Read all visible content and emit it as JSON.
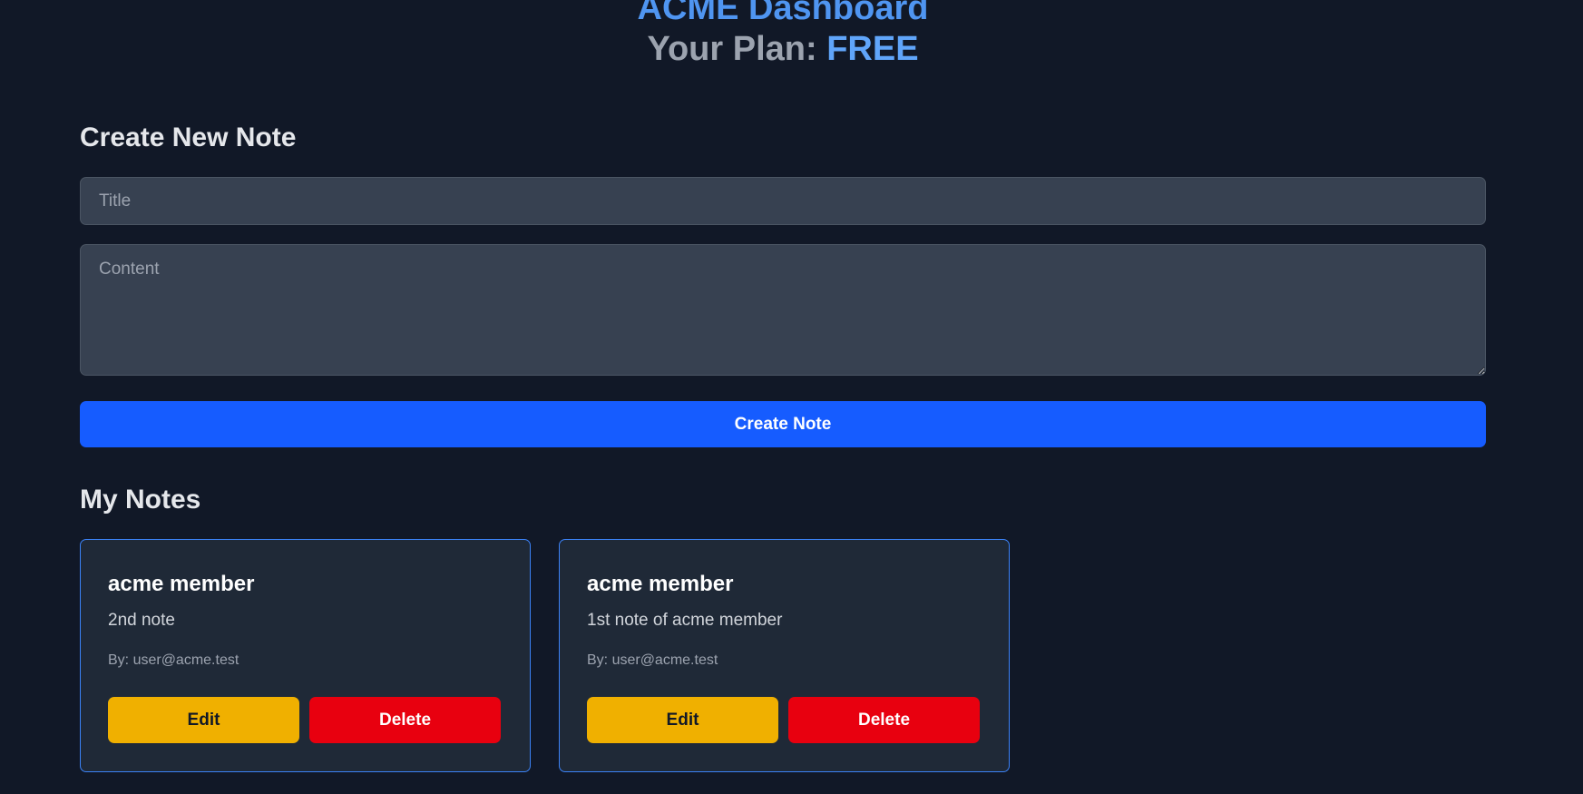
{
  "header": {
    "title": "ACME Dashboard",
    "plan_label": "Your Plan: ",
    "plan_value": "FREE"
  },
  "create_section": {
    "heading": "Create New Note",
    "title_placeholder": "Title",
    "title_value": "",
    "content_placeholder": "Content",
    "content_value": "",
    "submit_label": "Create Note"
  },
  "notes_section": {
    "heading": "My Notes",
    "notes": [
      {
        "title": "acme member",
        "body": "2nd note",
        "author": "By: user@acme.test",
        "edit_label": "Edit",
        "delete_label": "Delete"
      },
      {
        "title": "acme member",
        "body": "1st note of acme member",
        "author": "By: user@acme.test",
        "edit_label": "Edit",
        "delete_label": "Delete"
      }
    ]
  },
  "colors": {
    "background": "#111827",
    "brand_title": "#4f95f1",
    "plan_value": "#60a5fa",
    "primary_button": "#165cff",
    "edit_button": "#f0b000",
    "delete_button": "#e8000f",
    "card_border": "#3b82f6"
  }
}
